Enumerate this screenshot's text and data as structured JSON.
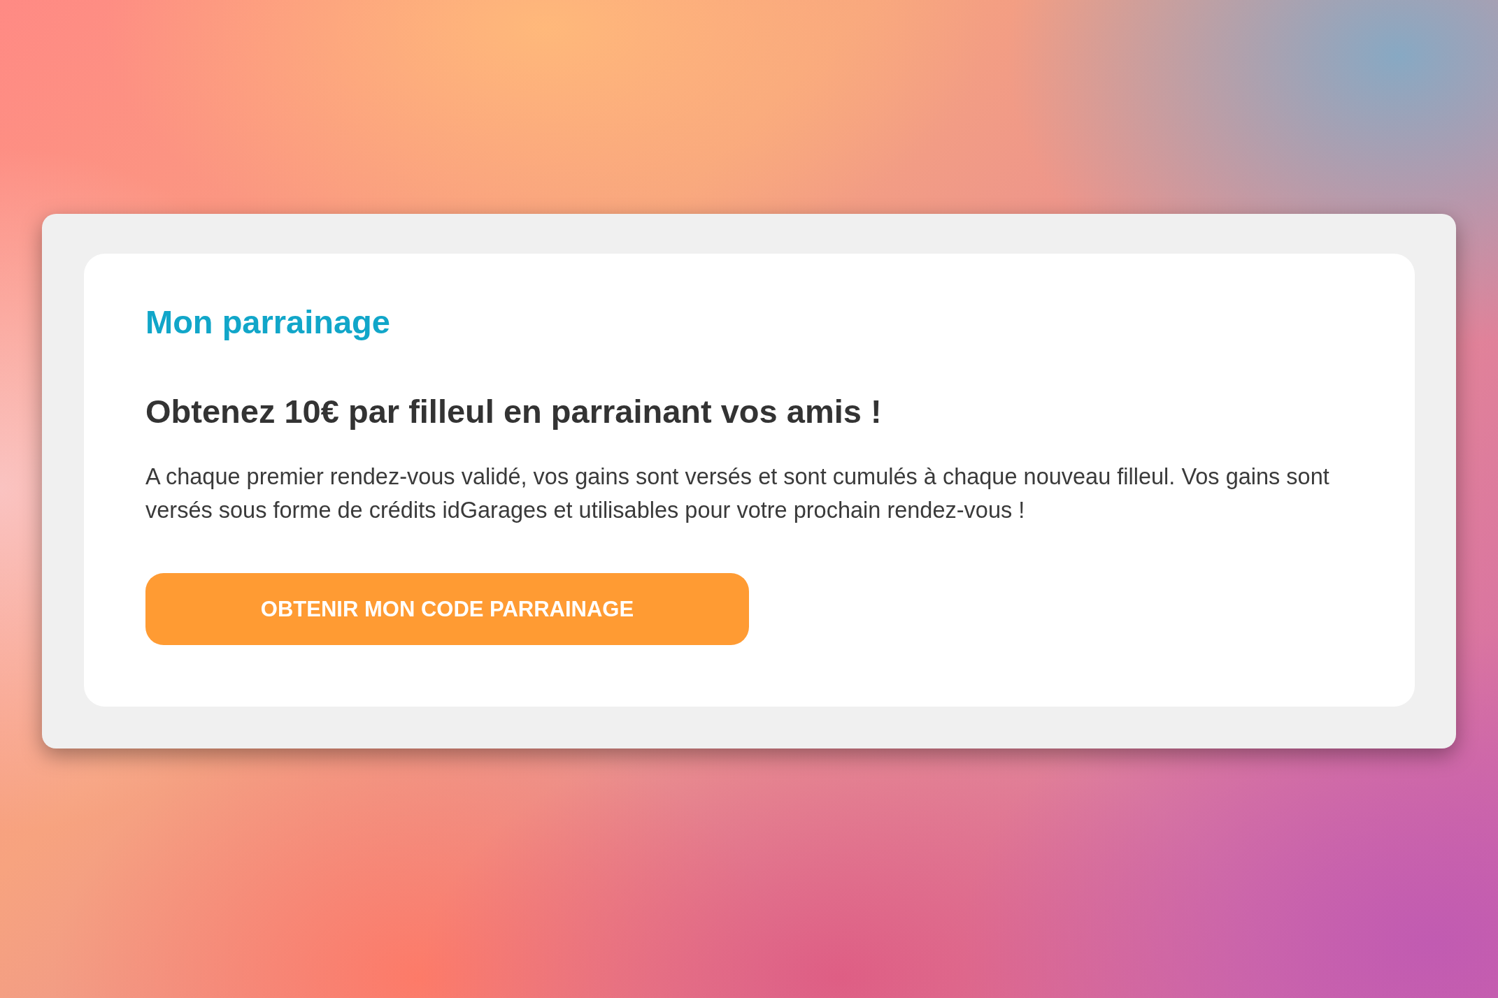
{
  "card": {
    "title": "Mon parrainage",
    "heading": "Obtenez 10€ par filleul en parrainant vos amis !",
    "description": "A chaque premier rendez-vous validé, vos gains sont versés et sont cumulés à chaque nouveau filleul. Vos gains sont versés sous forme de crédits idGarages et utilisables pour votre prochain rendez-vous !",
    "button": "OBTENIR MON CODE PARRAINAGE"
  }
}
